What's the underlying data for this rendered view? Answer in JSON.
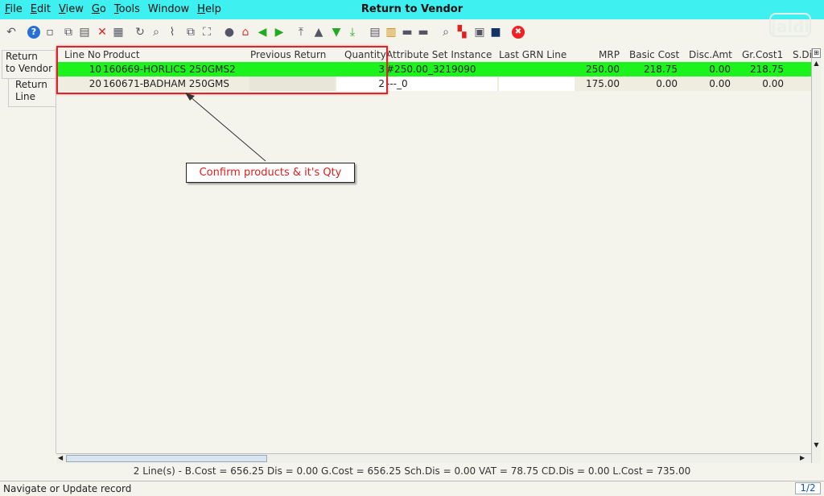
{
  "window": {
    "title": "Return to Vendor",
    "menu": [
      {
        "pre": "",
        "u": "F",
        "post": "ile"
      },
      {
        "pre": "",
        "u": "E",
        "post": "dit"
      },
      {
        "pre": "",
        "u": "V",
        "post": "iew"
      },
      {
        "pre": "",
        "u": "G",
        "post": "o"
      },
      {
        "pre": "",
        "u": "T",
        "post": "ools"
      },
      {
        "pre": "Window",
        "u": "",
        "post": ""
      },
      {
        "pre": "",
        "u": "H",
        "post": "elp"
      }
    ],
    "logo": "jaldi"
  },
  "toolbar": {
    "icons": [
      "undo-icon",
      "help-icon",
      "new-record-icon",
      "copy-record-icon",
      "save-icon",
      "delete-icon",
      "grid-toggle-icon",
      "refresh-icon",
      "find-icon",
      "attachment-icon",
      "multi-window-icon",
      "fullscreen-icon",
      "history-icon",
      "home-icon",
      "previous-icon",
      "next-icon",
      "first-record-icon",
      "previous-record-icon",
      "next-record-icon",
      "last-record-icon",
      "report-icon",
      "archive-icon",
      "print-icon",
      "print-preview-icon",
      "zoom-across-icon",
      "workflow-icon",
      "product-info-icon",
      "settings-icon",
      "close-icon"
    ]
  },
  "tabs": {
    "parent": {
      "line1": "Return",
      "line2": "to Vendor"
    },
    "child": {
      "line1": "Return",
      "line2": "Line"
    }
  },
  "grid": {
    "headers": {
      "line_no": "Line No",
      "product": "Product",
      "previous_return": "Previous Return",
      "quantity": "Quantity",
      "asi": "Attribute Set Instance",
      "last_grn": "Last GRN Line",
      "mrp": "MRP",
      "basic_cost": "Basic Cost",
      "disc_amt": "Disc.Amt",
      "gr_cost1": "Gr.Cost1",
      "sdi": "S.Di"
    },
    "rows": [
      {
        "line_no": "10",
        "product": "160669-HORLICS 250GMS2",
        "previous_return": "",
        "quantity": "3",
        "asi": "#250.00_3219090",
        "last_grn": "",
        "mrp": "250.00",
        "basic_cost": "218.75",
        "disc_amt": "0.00",
        "gr_cost1": "218.75",
        "sdi": ""
      },
      {
        "line_no": "20",
        "product": "160671-BADHAM 250GMS",
        "previous_return": "",
        "quantity": "2",
        "asi": "---_0",
        "last_grn": "",
        "mrp": "175.00",
        "basic_cost": "0.00",
        "disc_amt": "0.00",
        "gr_cost1": "0.00",
        "sdi": ""
      }
    ],
    "selected_row_color": "#1cf21c"
  },
  "annotation": {
    "text": "Confirm products & it's Qty",
    "color": "#e21c1c"
  },
  "status": {
    "summary": "2 Line(s) -   B.Cost = 656.25    Dis = 0.00    G.Cost = 656.25    Sch.Dis = 0.00    VAT = 78.75    CD.Dis = 0.00    L.Cost = 735.00",
    "message": "Navigate or Update record",
    "pager": "1/2"
  }
}
